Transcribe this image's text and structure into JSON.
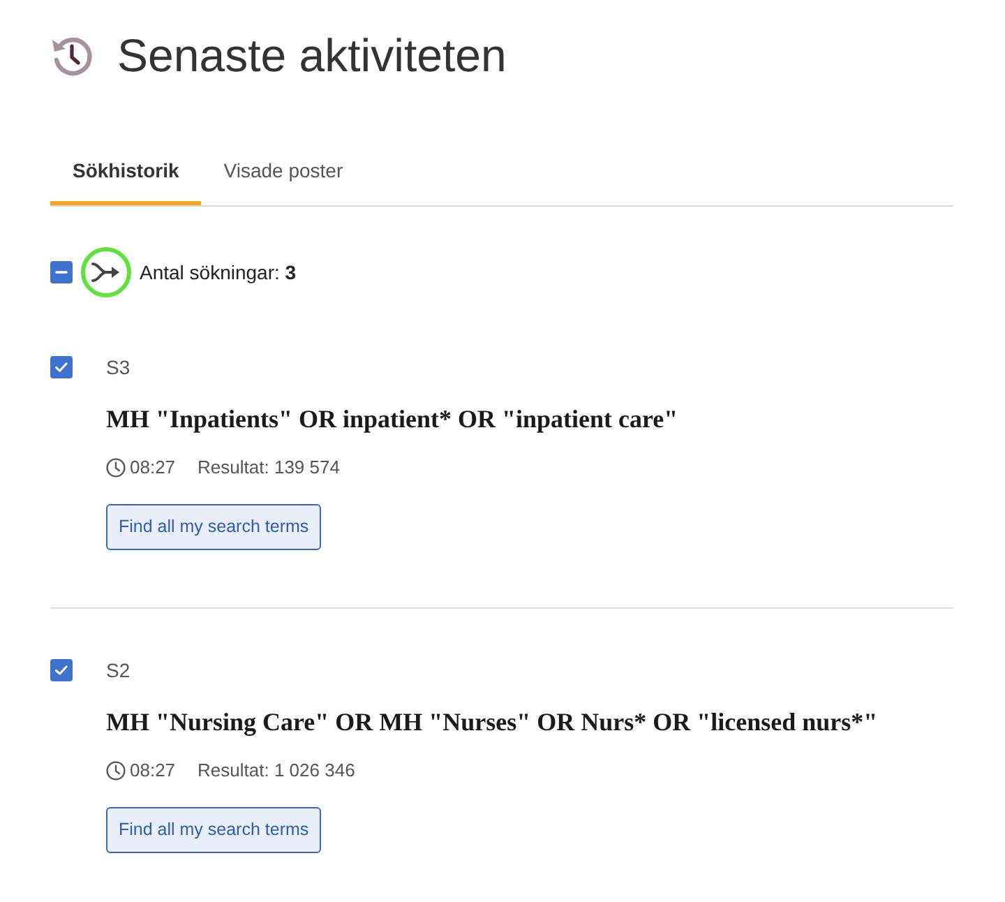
{
  "header": {
    "title": "Senaste aktiviteten"
  },
  "tabs": [
    {
      "label": "Sökhistorik",
      "selected": true
    },
    {
      "label": "Visade poster",
      "selected": false
    }
  ],
  "summary": {
    "indeterminate": true,
    "combine_focused": true,
    "label": "Antal sökningar: **3**"
  },
  "searches": [
    {
      "number": "S3",
      "checked": true,
      "query": "MH \"Inpatients\" OR inpatient* OR \"inpatient care\"",
      "time": "08:27",
      "results": "Resultat: 139 574",
      "button": "Find all my search terms"
    },
    {
      "number": "S2",
      "checked": true,
      "query": "MH \"Nursing Care\" OR MH \"Nurses\" OR Nurs* OR \"licensed nurs*\"",
      "time": "08:27",
      "results": "Resultat: 1 026 346",
      "button": "Find all my search terms"
    }
  ]
}
